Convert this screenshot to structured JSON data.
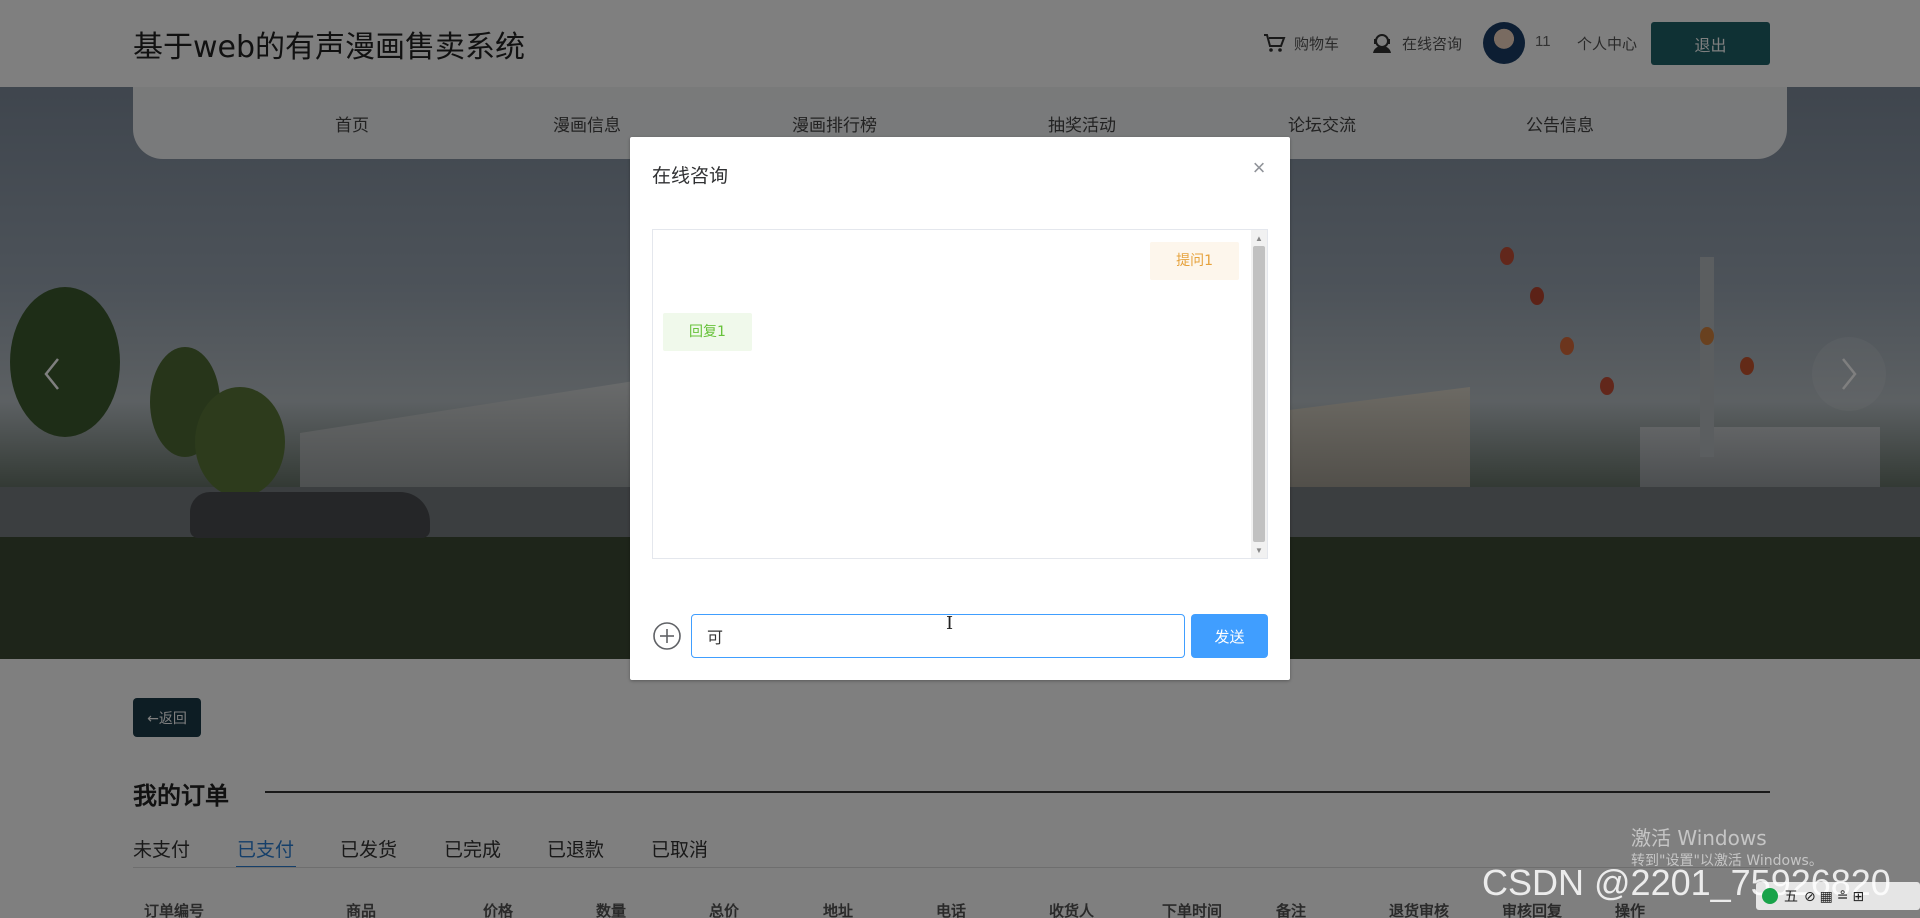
{
  "header": {
    "site_title": "基于web的有声漫画售卖系统",
    "cart_label": "购物车",
    "consult_label": "在线咨询",
    "username": "11",
    "profile_label": "个人中心",
    "logout_label": "退出"
  },
  "nav": {
    "items": [
      {
        "label": "首页"
      },
      {
        "label": "漫画信息"
      },
      {
        "label": "漫画排行榜"
      },
      {
        "label": "抽奖活动"
      },
      {
        "label": "论坛交流"
      },
      {
        "label": "公告信息"
      }
    ]
  },
  "page": {
    "back_label": "←返回",
    "orders_title": "我的订单",
    "tabs": [
      {
        "label": "未支付"
      },
      {
        "label": "已支付"
      },
      {
        "label": "已发货"
      },
      {
        "label": "已完成"
      },
      {
        "label": "已退款"
      },
      {
        "label": "已取消"
      }
    ],
    "active_tab": "已支付",
    "columns": [
      "订单编号",
      "商品",
      "价格",
      "数量",
      "总价",
      "地址",
      "电话",
      "收货人",
      "下单时间",
      "备注",
      "退货审核",
      "审核回复",
      "操作"
    ]
  },
  "dialog": {
    "title": "在线咨询",
    "close_label": "×",
    "messages": [
      {
        "role": "question",
        "text": "提问1"
      },
      {
        "role": "reply",
        "text": "回复1"
      }
    ],
    "input_value": "可",
    "send_label": "发送"
  },
  "watermark": {
    "line1": "激活 Windows",
    "line2": "转到\"设置\"以激活 Windows。",
    "csdn": "CSDN @2201_75926820"
  },
  "tray": {
    "ime": "五",
    "items": "⊘ ▦ ≗ ⊞"
  },
  "colors": {
    "primary": "#409eff",
    "header_button": "#1e6368",
    "active_tab": "#2a7fd4",
    "question_bubble_bg": "#fdf6ec",
    "question_text": "#e6a23c",
    "reply_bubble_bg": "#f0f9eb",
    "reply_text": "#67c23a"
  }
}
